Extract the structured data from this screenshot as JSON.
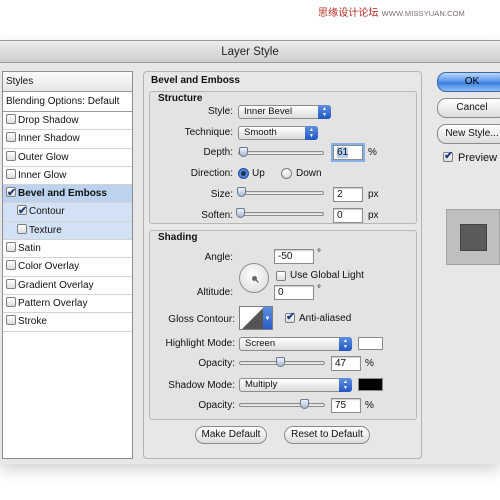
{
  "watermark": {
    "text": "思缘设计论坛",
    "url": "WWW.MISSYUAN.COM"
  },
  "window": {
    "title": "Layer Style"
  },
  "sidebar": {
    "header": "Styles",
    "blending": "Blending Options: Default",
    "items": [
      {
        "label": "Drop Shadow",
        "checked": false
      },
      {
        "label": "Inner Shadow",
        "checked": false
      },
      {
        "label": "Outer Glow",
        "checked": false
      },
      {
        "label": "Inner Glow",
        "checked": false
      },
      {
        "label": "Bevel and Emboss",
        "checked": true
      },
      {
        "label": "Contour",
        "checked": true
      },
      {
        "label": "Texture",
        "checked": false
      },
      {
        "label": "Satin",
        "checked": false
      },
      {
        "label": "Color Overlay",
        "checked": false
      },
      {
        "label": "Gradient Overlay",
        "checked": false
      },
      {
        "label": "Pattern Overlay",
        "checked": false
      },
      {
        "label": "Stroke",
        "checked": false
      }
    ]
  },
  "bevel": {
    "title": "Bevel and Emboss",
    "structure": {
      "title": "Structure",
      "style_label": "Style:",
      "style_value": "Inner Bevel",
      "technique_label": "Technique:",
      "technique_value": "Smooth",
      "depth_label": "Depth:",
      "depth_value": "61",
      "depth_unit": "%",
      "direction_label": "Direction:",
      "direction_up": "Up",
      "direction_down": "Down",
      "size_label": "Size:",
      "size_value": "2",
      "size_unit": "px",
      "soften_label": "Soften:",
      "soften_value": "0",
      "soften_unit": "px"
    },
    "shading": {
      "title": "Shading",
      "angle_label": "Angle:",
      "angle_value": "-50",
      "angle_unit": "°",
      "global_light_label": "Use Global Light",
      "altitude_label": "Altitude:",
      "altitude_value": "0",
      "altitude_unit": "°",
      "gloss_label": "Gloss Contour:",
      "antialiased_label": "Anti-aliased",
      "highlight_mode_label": "Highlight Mode:",
      "highlight_mode_value": "Screen",
      "highlight_color": "#ffffff",
      "opacity1_label": "Opacity:",
      "opacity1_value": "47",
      "opacity1_unit": "%",
      "shadow_mode_label": "Shadow Mode:",
      "shadow_mode_value": "Multiply",
      "shadow_color": "#000000",
      "opacity2_label": "Opacity:",
      "opacity2_value": "75",
      "opacity2_unit": "%"
    },
    "make_default": "Make Default",
    "reset_default": "Reset to Default"
  },
  "actions": {
    "ok": "OK",
    "cancel": "Cancel",
    "new_style": "New Style...",
    "preview": "Preview"
  }
}
